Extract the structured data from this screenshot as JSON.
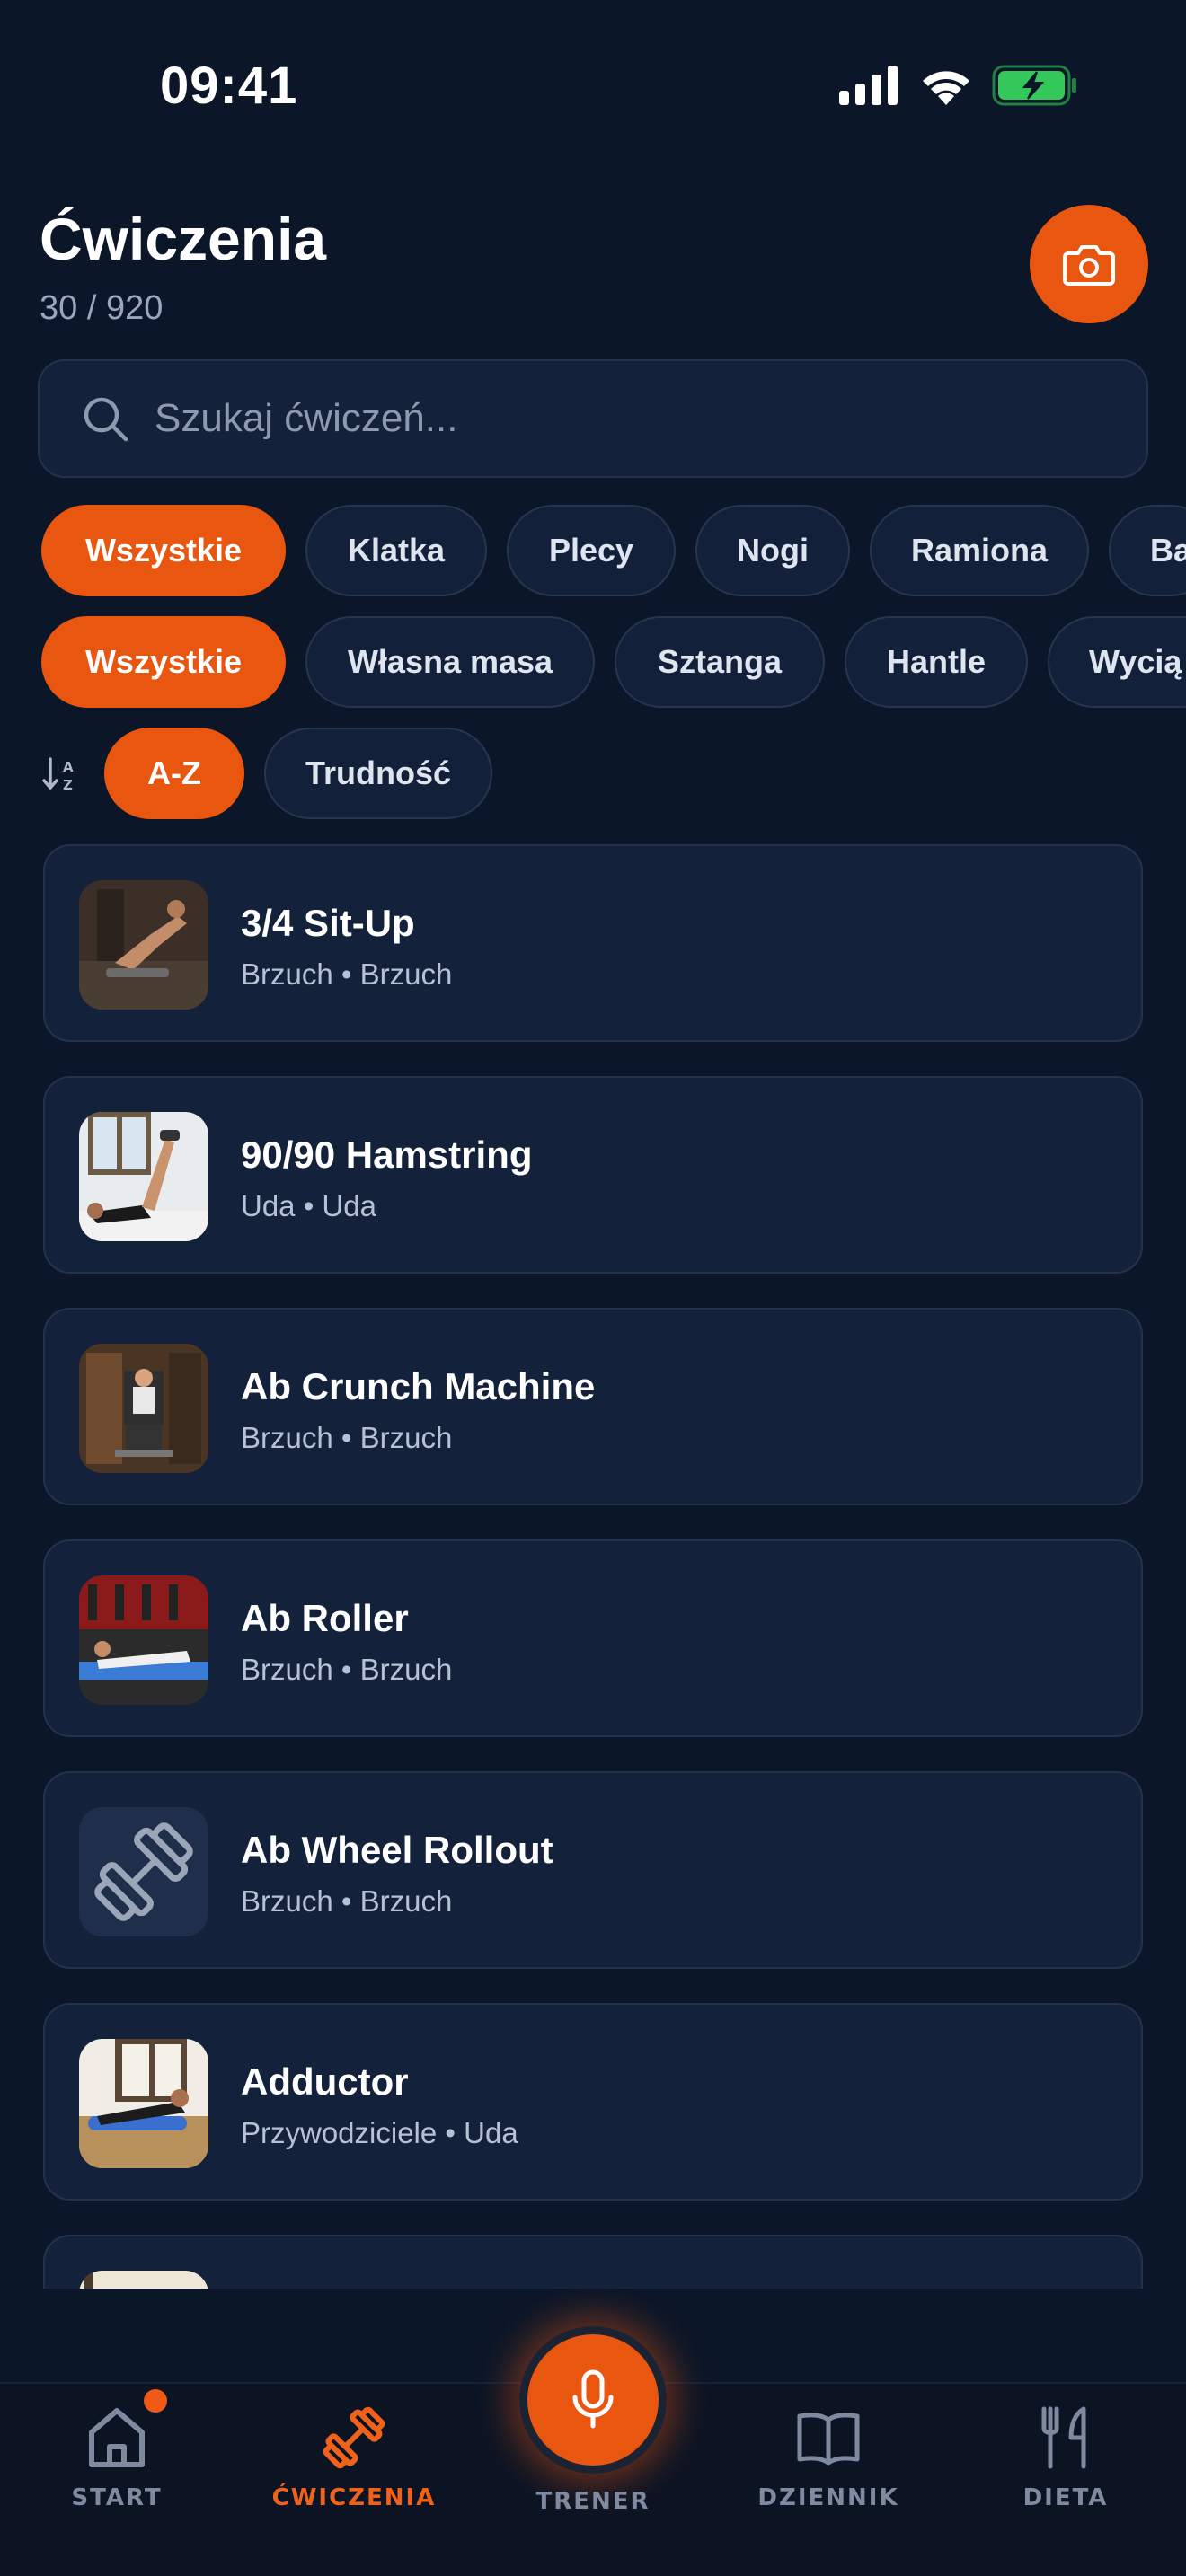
{
  "status_bar": {
    "time": "09:41"
  },
  "header": {
    "title": "Ćwiczenia",
    "count": "30 / 920"
  },
  "search": {
    "placeholder": "Szukaj ćwiczeń..."
  },
  "filters": {
    "muscle_groups": [
      "Wszystkie",
      "Klatka",
      "Plecy",
      "Nogi",
      "Ramiona",
      "Ba"
    ],
    "equipment": [
      "Wszystkie",
      "Własna masa",
      "Sztanga",
      "Hantle",
      "Wycią"
    ],
    "sort": [
      "A-Z",
      "Trudność"
    ]
  },
  "exercises": [
    {
      "name": "3/4 Sit-Up",
      "meta": "Brzuch • Brzuch",
      "thumb": "photo"
    },
    {
      "name": "90/90 Hamstring",
      "meta": "Uda • Uda",
      "thumb": "photo"
    },
    {
      "name": "Ab Crunch Machine",
      "meta": "Brzuch • Brzuch",
      "thumb": "photo"
    },
    {
      "name": "Ab Roller",
      "meta": "Brzuch • Brzuch",
      "thumb": "photo"
    },
    {
      "name": "Ab Wheel Rollout",
      "meta": "Brzuch • Brzuch",
      "thumb": "dumbbell-icon"
    },
    {
      "name": "Adductor",
      "meta": "Przywodziciele • Uda",
      "thumb": "photo"
    }
  ],
  "tab_bar": {
    "start": "START",
    "exercises": "ĆWICZENIA",
    "coach": "TRENER",
    "journal": "DZIENNIK",
    "diet": "DIETA"
  },
  "colors": {
    "background": "#0b1628",
    "card": "#14213a",
    "accent": "#e8560f",
    "battery": "#34c759"
  }
}
